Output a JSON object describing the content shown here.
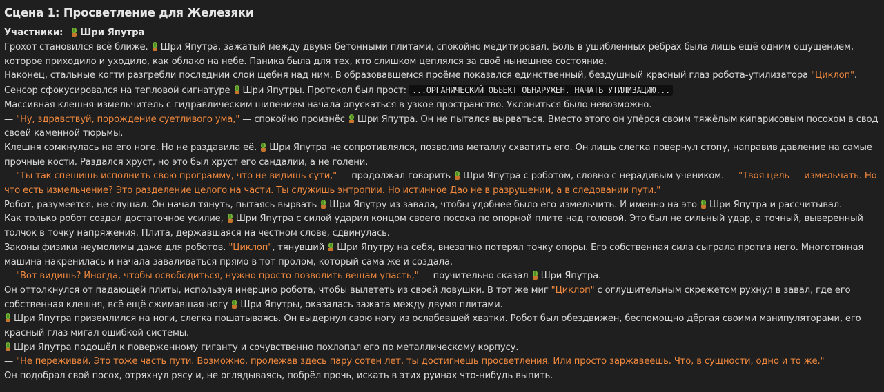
{
  "scene": {
    "title": "Сцена 1: Просветление для Железяки"
  },
  "participants": {
    "label": "Участники:",
    "name": "Шри Япутра"
  },
  "icons": {
    "character_icon": "potted-plant-icon"
  },
  "colors": {
    "background": "#1f1f1f",
    "text": "#d9d9d9",
    "quote": "#f0883e",
    "code_background": "#0f0f0f"
  },
  "story": {
    "s1_a": "Грохот становился всё ближе. ",
    "s1_b": "Шри Япутра, зажатый между двумя бетонными плитами, спокойно медитировал. Боль в ушибленных рёбрах была лишь ещё одним ощущением, которое приходило и уходило, как облако на небе. Паника была для тех, кто слишком цеплялся за своё нынешнее состояние.",
    "s2_a": "Наконец, стальные когти разгребли последний слой щебня над ним. В образовавшемся проёме показался единственный, бездушный красный глаз робота-утилизатора ",
    "s2_q": "\"Циклоп\"",
    "s2_b": ".",
    "s3_a": "Сенсор сфокусировался на тепловой сигнатуре ",
    "s3_b": "Шри Япутры. Протокол был прост: ",
    "s3_code": "...ОРГАНИЧЕСКИЙ ОБЪЕКТ ОБНАРУЖЕН. НАЧАТЬ УТИЛИЗАЦИЮ...",
    "s4": "Массивная клешня-измельчитель с гидравлическим шипением начала опускаться в узкое пространство. Уклониться было невозможно.",
    "s5_dash": "— ",
    "s5_q": "\"Ну, здравствуй, порождение суетливого ума,\"",
    "s5_a": " — спокойно произнёс ",
    "s5_b": "Шри Япутра. Он не пытался вырваться. Вместо этого он упёрся своим тяжёлым кипарисовым посохом в свод своей каменной тюрьмы.",
    "s6_a": "Клешня сомкнулась на его ноге. Но не раздавила её. ",
    "s6_b": "Шри Япутра не сопротивлялся, позволив металлу схватить его. Он лишь слегка повернул стопу, направив давление на самые прочные кости. Раздался хруст, но это был хруст его сандалии, а не голени.",
    "s7_dash": "— ",
    "s7_q1": "\"Ты так спешишь исполнить свою программу, что не видишь сути,\"",
    "s7_a": " — продолжал говорить ",
    "s7_b": "Шри Япутра с роботом, словно с нерадивым учеником. — ",
    "s7_q2": "\"Твоя цель — измельчать. Но что есть измельчение? Это разделение целого на части. Ты служишь энтропии. Но истинное Дао не в разрушении, а в следовании пути.\"",
    "s8_a": "Робот, разумеется, не слушал. Он начал тянуть, пытаясь вырвать ",
    "s8_b": "Шри Япутру из завала, чтобы удобнее было его измельчить. И именно на это ",
    "s8_c": "Шри Япутра и рассчитывал.",
    "s9_a": "Как только робот создал достаточное усилие, ",
    "s9_b": "Шри Япутра с силой ударил концом своего посоха по опорной плите над головой. Это был не сильный удар, а точный, выверенный толчок в точку напряжения. Плита, державшаяся на честном слове, сдвинулась.",
    "s10_a": "Законы физики неумолимы даже для роботов. ",
    "s10_q": "\"Циклоп\"",
    "s10_b": ", тянувший ",
    "s10_c": "Шри Япутру на себя, внезапно потерял точку опоры. Его собственная сила сыграла против него. Многотонная машина накренилась и начала заваливаться прямо в тот пролом, который сама же и создала.",
    "s11_dash": "— ",
    "s11_q": "\"Вот видишь? Иногда, чтобы освободиться, нужно просто позволить вещам упасть,\"",
    "s11_a": " — поучительно сказал ",
    "s11_b": "Шри Япутра.",
    "s12_a": "Он оттолкнулся от падающей плиты, используя инерцию робота, чтобы вылететь из своей ловушки. В тот же миг ",
    "s12_q": "\"Циклоп\"",
    "s12_b": " с оглушительным скрежетом рухнул в завал, где его собственная клешня, всё ещё сжимавшая ногу ",
    "s12_c": "Шри Япутры, оказалась зажата между двумя плитами.",
    "s13_a": "Шри Япутра приземлился на ноги, слегка пошатываясь. Он выдернул свою ногу из ослабевшей хватки. Робот был обездвижен, беспомощно дёргая своими манипуляторами, его красный глаз мигал ошибкой системы.",
    "s14_a": "Шри Япутра подошёл к поверженному гиганту и сочувственно похлопал его по металлическому корпусу.",
    "s15_dash": "— ",
    "s15_q": "\"Не переживай. Это тоже часть пути. Возможно, пролежав здесь пару сотен лет, ты достигнешь просветления. Или просто заржавеешь. Что, в сущности, одно и то же.\"",
    "s16": "Он подобрал свой посох, отряхнул рясу и, не оглядываясь, побрёл прочь, искать в этих руинах что-нибудь выпить."
  }
}
